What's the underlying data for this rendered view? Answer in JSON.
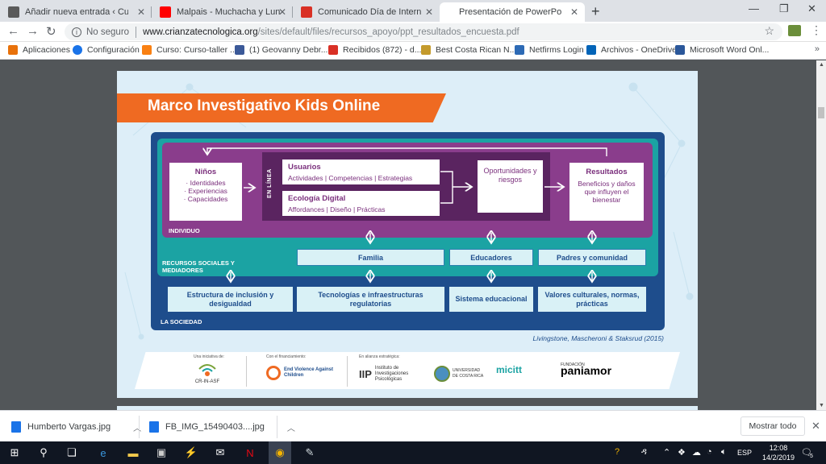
{
  "tabs": [
    {
      "title": "Añadir nueva entrada ‹ CulturaCR",
      "favicon_color": "#5a5a5a",
      "icon": "wordpress-icon"
    },
    {
      "title": "Malpais - Muchacha y Luna - You",
      "favicon_color": "#ff0000",
      "icon": "youtube-icon"
    },
    {
      "title": "Comunicado Día de Internet Seg",
      "favicon_color": "#d93025",
      "icon": "gmail-icon"
    },
    {
      "title": "Presentación de PowerPoint",
      "active": true
    }
  ],
  "address": {
    "security": "No seguro",
    "host": "www.crianzatecnologica.org",
    "path": "/sites/default/files/recursos_apoyo/ppt_resultados_encuesta.pdf"
  },
  "bookmarks": [
    {
      "label": "Aplicaciones",
      "icon": "apps-grid-icon",
      "color": "#e8710a"
    },
    {
      "label": "Configuración",
      "icon": "gear-icon",
      "color": "#1a73e8"
    },
    {
      "label": "Curso: Curso-taller ...",
      "icon": "moodle-icon",
      "color": "#f98012"
    },
    {
      "label": "(1) Geovanny Debr...",
      "icon": "facebook-icon",
      "color": "#3b5998"
    },
    {
      "label": "Recibidos (872) - d...",
      "icon": "gmail-icon",
      "color": "#d93025"
    },
    {
      "label": "Best Costa Rican N...",
      "icon": "bookmark-icon",
      "color": "#c49a2c"
    },
    {
      "label": "Netfirms Login",
      "icon": "netfirms-icon",
      "color": "#2d6ab5"
    },
    {
      "label": "Archivos - OneDrive",
      "icon": "onedrive-icon",
      "color": "#0364b8"
    },
    {
      "label": "Microsoft Word Onl...",
      "icon": "word-icon",
      "color": "#2b579a"
    }
  ],
  "slide": {
    "title": "Marco Investigativo Kids Online",
    "ninos": {
      "title": "Niños",
      "items": [
        "· Identidades",
        "· Experiencias",
        "· Capacidades"
      ]
    },
    "en_linea": "EN LÍNEA",
    "usuarios": {
      "title": "Usuarios",
      "items": "Actividades | Competencias | Estrategias"
    },
    "ecologia": {
      "title": "Ecología Digital",
      "items": "Affordances | Diseño | Prácticas"
    },
    "oportunidades": "Oportunidades y riesgos",
    "resultados": {
      "title": "Resultados",
      "text": "Beneficios y daños que influyen el bienestar"
    },
    "individuo_label": "INDIVIDUO",
    "recursos_label": "RECURSOS SOCIALES Y MEDIADORES",
    "sociedad_label": "LA SOCIEDAD",
    "mediators": [
      "Familia",
      "Educadores",
      "Padres y comunidad"
    ],
    "society_boxes": [
      "Estructura de inclusión y desigualdad",
      "Tecnologías e infraestructuras regulatorias",
      "Sistema educacional",
      "Valores culturales, normas, prácticas"
    ],
    "citation": "Livingstone, Mascheroni & Staksrud (2015)",
    "footer": {
      "cap1": "Una iniciativa de:",
      "cap2": "Con el financiamiento:",
      "cap3": "En alianza estratégica:",
      "logo1": "CR-IN-ASF",
      "logo2": "End Violence Against Children",
      "logo3a": "IIP",
      "logo3b": "Instituto de Investigaciones Psicológicas",
      "logo4": "UNIVERSIDAD DE COSTA RICA",
      "logo5": "micitt",
      "logo6": "paniamor",
      "logo6cap": "FUNDACIÓN"
    }
  },
  "downloads": [
    {
      "name": "Humberto Vargas.jpg"
    },
    {
      "name": "FB_IMG_15490403....jpg"
    }
  ],
  "show_all": "Mostrar todo",
  "tray": {
    "language": "ESP",
    "time": "12:08",
    "date": "14/2/2019",
    "notifications": "5"
  }
}
